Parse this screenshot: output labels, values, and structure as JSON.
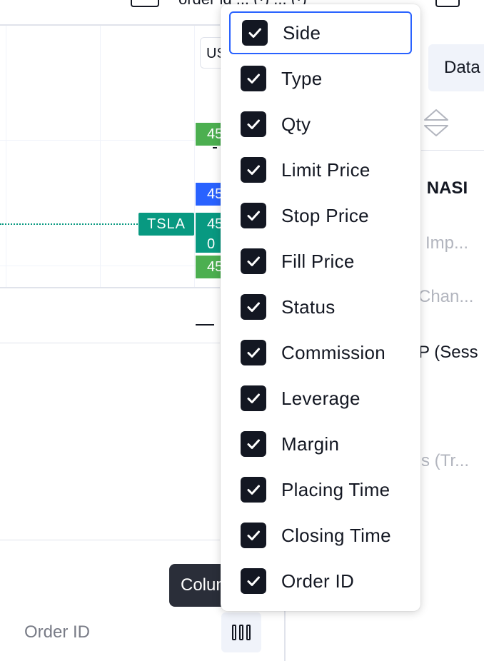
{
  "top": {
    "clip_text": "order id ... (·) ... (·)"
  },
  "chart": {
    "currency": "US",
    "ticker": "TSLA",
    "price_labels": {
      "p1": "45",
      "p2": "45",
      "p3": "45",
      "p3b": "0",
      "p4": "45"
    }
  },
  "bottom_panel": {
    "tooltip": "Columns",
    "footer_label": "Order ID"
  },
  "right_panel": {
    "tab": "Data",
    "lines": [
      "A · NASI",
      "Imp...",
      "Chan...",
      "P (Sess",
      "s (Tr..."
    ]
  },
  "columns_menu": {
    "items": [
      {
        "label": "Side",
        "checked": true,
        "focused": true
      },
      {
        "label": "Type",
        "checked": true
      },
      {
        "label": "Qty",
        "checked": true
      },
      {
        "label": "Limit Price",
        "checked": true
      },
      {
        "label": "Stop Price",
        "checked": true
      },
      {
        "label": "Fill Price",
        "checked": true
      },
      {
        "label": "Status",
        "checked": true
      },
      {
        "label": "Commission",
        "checked": true
      },
      {
        "label": "Leverage",
        "checked": true
      },
      {
        "label": "Margin",
        "checked": true
      },
      {
        "label": "Placing Time",
        "checked": true
      },
      {
        "label": "Closing Time",
        "checked": true
      },
      {
        "label": "Order ID",
        "checked": true
      }
    ]
  },
  "colors": {
    "accent": "#2962ff",
    "teal": "#089981",
    "green": "#4caf50",
    "dark": "#131722"
  }
}
